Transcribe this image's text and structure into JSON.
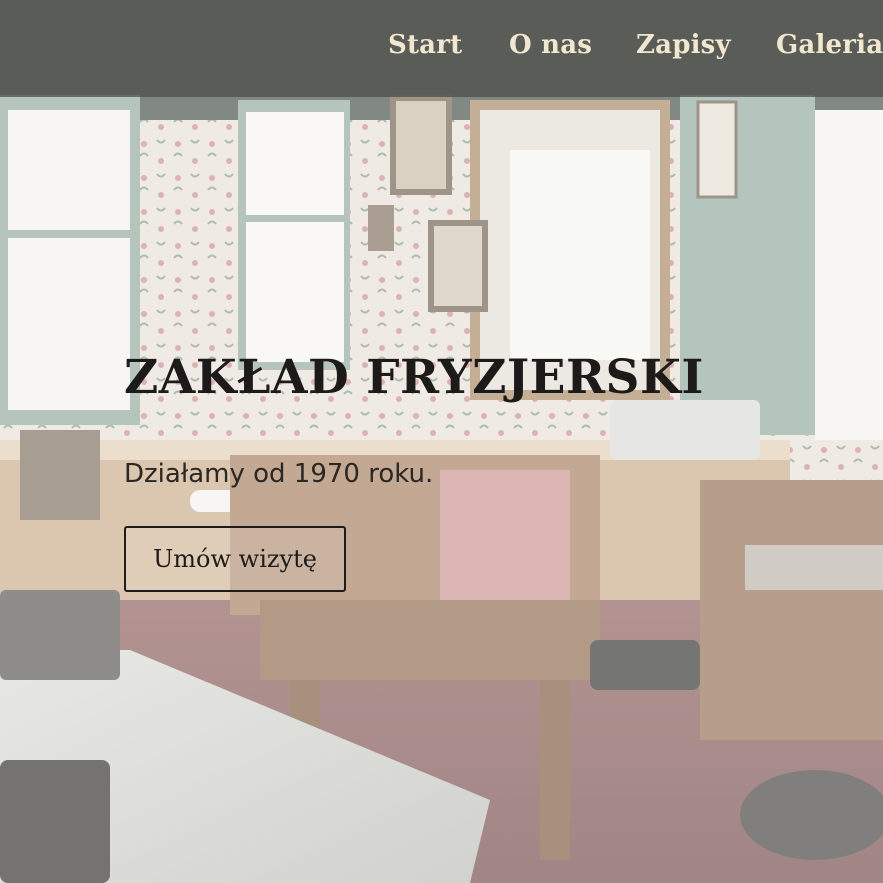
{
  "nav": {
    "items": [
      {
        "label": "Start"
      },
      {
        "label": "O nas"
      },
      {
        "label": "Zapisy"
      },
      {
        "label": "Galeria"
      }
    ]
  },
  "hero": {
    "title": "ZAKŁAD FRYZJERSKI",
    "subtitle": "Działamy od 1970 roku.",
    "cta_label": "Umów wizytę",
    "background_description": "vintage barber shop interior"
  },
  "colors": {
    "nav_text": "#f1e6cf",
    "nav_bg": "#4b4b46",
    "title_text": "#1d1b19",
    "button_border": "#1e1c1a"
  }
}
